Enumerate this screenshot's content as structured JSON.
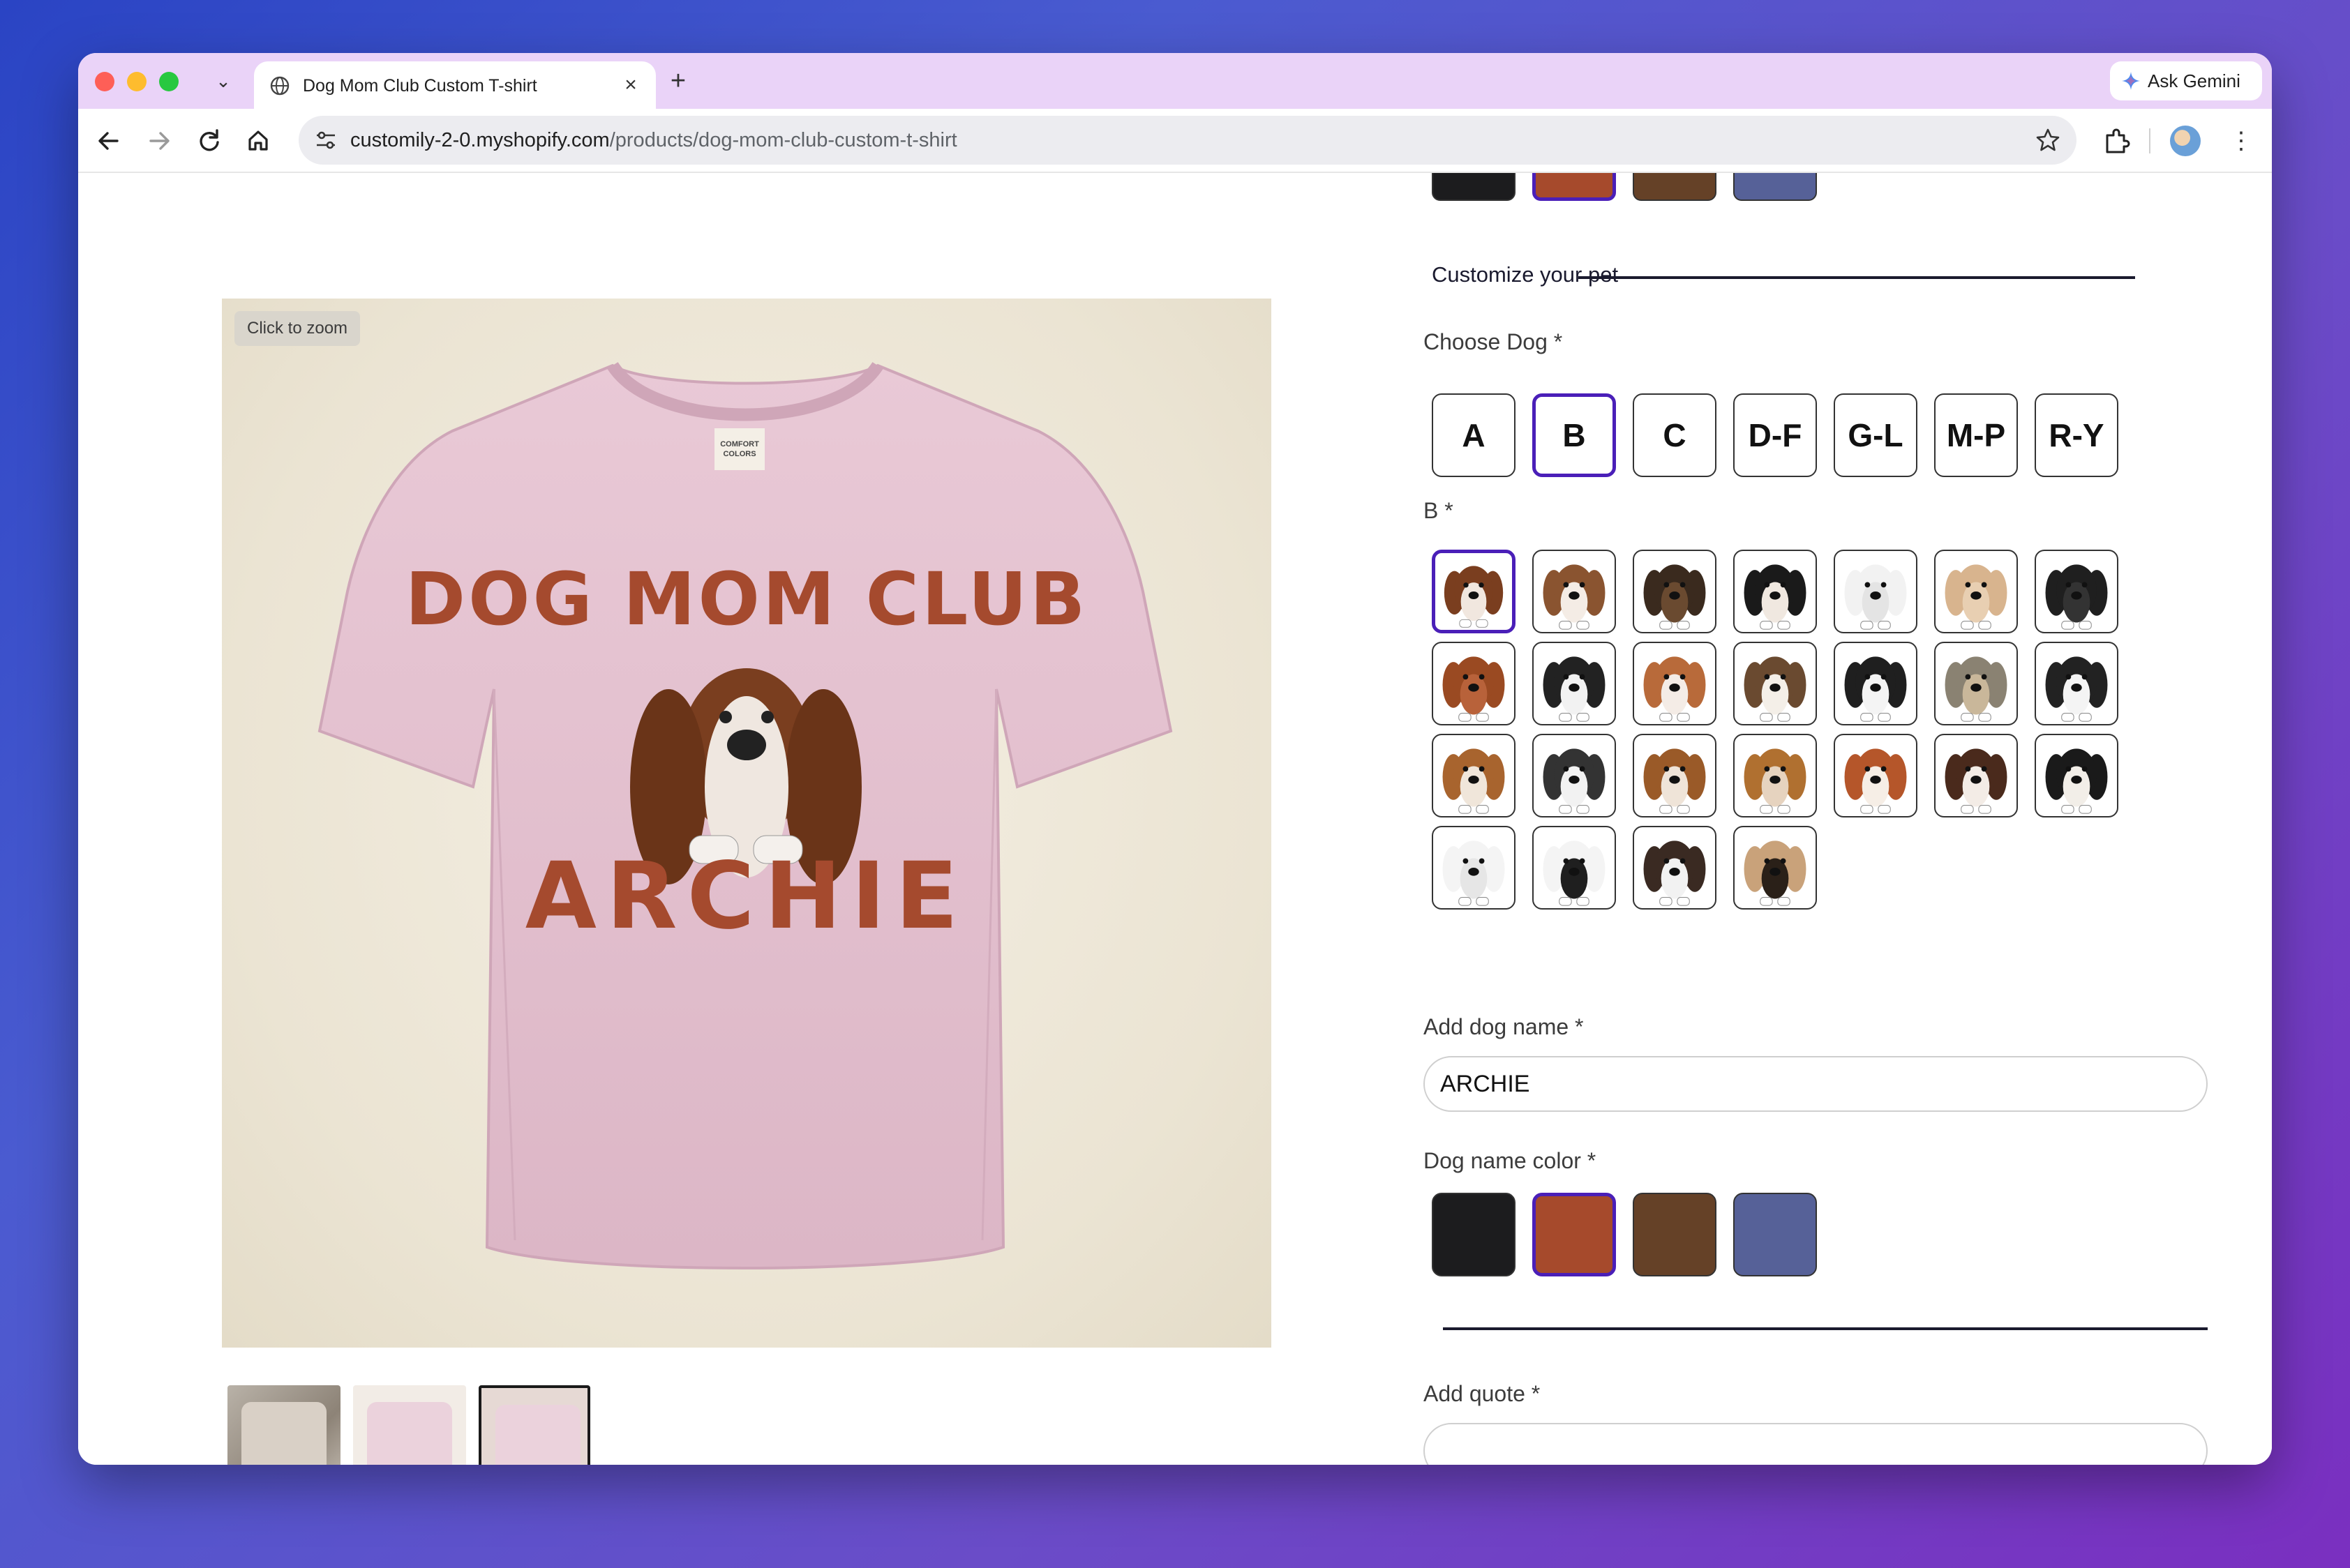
{
  "browser": {
    "tab_title": "Dog Mom Club Custom T-shirt",
    "tab_close": "×",
    "new_tab": "+",
    "tab_list": "⌄",
    "gemini_label": "Ask Gemini",
    "url_host": "customily-2-0.myshopify.com",
    "url_path": "/products/dog-mom-club-custom-t-shirt",
    "menu": "⋮"
  },
  "product": {
    "zoom_hint": "Click to zoom",
    "shirt_heading": "DOG MOM CLUB",
    "shirt_name": "ARCHIE",
    "shirt_brand": "COMFORT COLORS",
    "thumbnails": [
      "thumbnail-1",
      "thumbnail-2",
      "thumbnail-3"
    ]
  },
  "customize": {
    "section_title": "Customize your pet",
    "choose_dog_label": "Choose Dog *",
    "letter_groups": [
      "A",
      "B",
      "C",
      "D-F",
      "G-L",
      "M-P",
      "R-Y"
    ],
    "selected_group": "B",
    "group_label": "B *",
    "dog_count": 25,
    "selected_dog": 0,
    "dog_name_label": "Add dog name *",
    "dog_name_value": "ARCHIE",
    "dog_name_color_label": "Dog name color *",
    "name_colors": [
      "#1c1c1e",
      "#a64a2c",
      "#654127",
      "#566198"
    ],
    "selected_color": "#a64a2c",
    "quote_label": "Add quote *",
    "quote_value": ""
  },
  "colors": {
    "accent": "#4a1fb8",
    "tab_bar": "#ead3f8"
  }
}
